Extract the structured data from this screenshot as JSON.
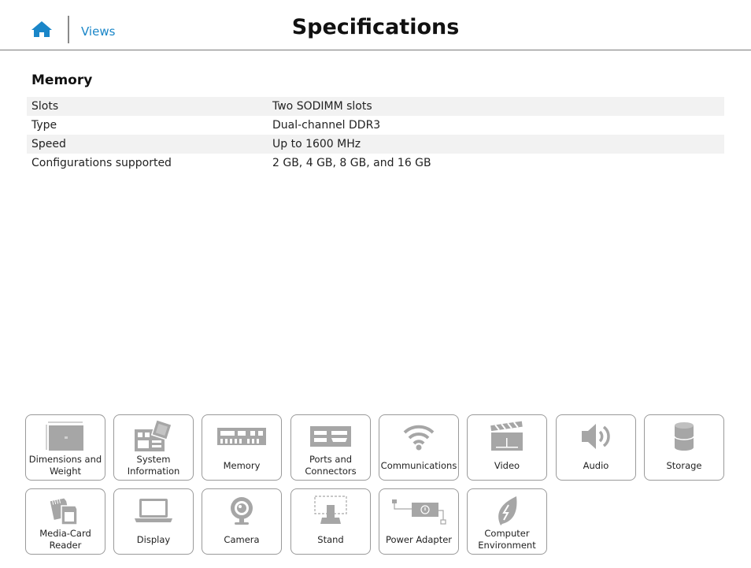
{
  "header": {
    "views_label": "Views",
    "title": "Specifications"
  },
  "section": {
    "title": "Memory",
    "rows": [
      {
        "label": "Slots",
        "value": "Two SODIMM slots"
      },
      {
        "label": "Type",
        "value": "Dual-channel DDR3"
      },
      {
        "label": "Speed",
        "value": "Up to 1600 MHz"
      },
      {
        "label": "Configurations supported",
        "value": "2 GB, 4 GB, 8 GB, and 16 GB"
      }
    ]
  },
  "tiles": [
    {
      "label": "Dimensions and Weight",
      "icon": "dimensions-icon"
    },
    {
      "label": "System Information",
      "icon": "system-board-icon"
    },
    {
      "label": "Memory",
      "icon": "memory-module-icon"
    },
    {
      "label": "Ports and Connectors",
      "icon": "ports-icon"
    },
    {
      "label": "Communications",
      "icon": "wifi-icon"
    },
    {
      "label": "Video",
      "icon": "clapperboard-icon"
    },
    {
      "label": "Audio",
      "icon": "speaker-icon"
    },
    {
      "label": "Storage",
      "icon": "drive-cylinder-icon"
    },
    {
      "label": "Media-Card Reader",
      "icon": "memory-cards-icon"
    },
    {
      "label": "Display",
      "icon": "laptop-icon"
    },
    {
      "label": "Camera",
      "icon": "webcam-icon"
    },
    {
      "label": "Stand",
      "icon": "stand-icon"
    },
    {
      "label": "Power Adapter",
      "icon": "power-adapter-icon"
    },
    {
      "label": "Computer Environment",
      "icon": "leaf-icon"
    }
  ],
  "colors": {
    "accent": "#1a86c8",
    "icon_gray": "#a6a6a6",
    "row_stripe": "#f2f2f2"
  }
}
